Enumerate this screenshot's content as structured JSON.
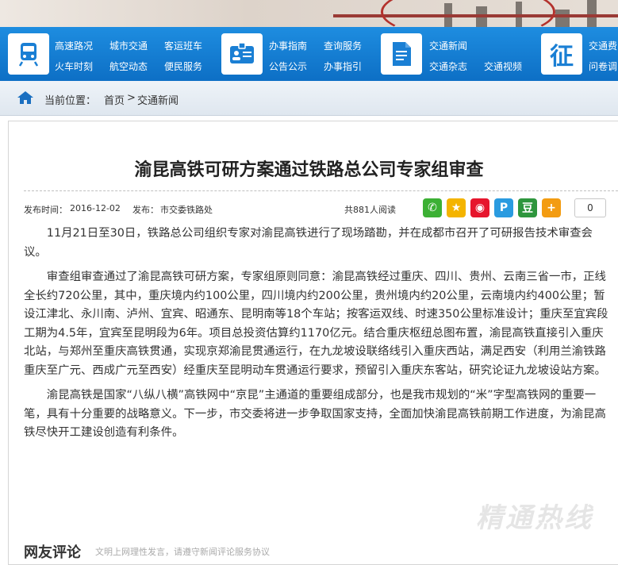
{
  "nav": {
    "groups": [
      {
        "icon": "train-icon",
        "links": [
          "高速路况",
          "城市交通",
          "客运班车",
          "火车时刻",
          "航空动态",
          "便民服务"
        ]
      },
      {
        "icon": "id-card-icon",
        "links": [
          "办事指南",
          "查询服务",
          "公告公示",
          "办事指引"
        ]
      },
      {
        "icon": "document-icon",
        "links": [
          "交通新闻",
          "交通视频",
          "交通杂志"
        ]
      },
      {
        "icon": "levy-icon",
        "icon_text": "征",
        "links": [
          "交通费",
          "问卷调"
        ]
      }
    ]
  },
  "breadcrumb": {
    "prefix": "当前位置：",
    "home": "首页",
    "sep": ">",
    "current": "交通新闻"
  },
  "article": {
    "title": "渝昆高铁可研方案通过铁路总公司专家组审查",
    "publish_label": "发布时间：",
    "publish_date": "2016-12-02",
    "source_label": "发布：",
    "source": "市交委铁路处",
    "reads": "共881人阅读",
    "share_count": "0",
    "paragraphs": [
      "11月21日至30日，铁路总公司组织专家对渝昆高铁进行了现场踏勘，并在成都市召开了可研报告技术审查会议。",
      "审查组审查通过了渝昆高铁可研方案，专家组原则同意：渝昆高铁经过重庆、四川、贵州、云南三省一市，正线全长约720公里，其中，重庆境内约100公里，四川境内约200公里，贵州境内约20公里，云南境内约400公里；暂设江津北、永川南、泸州、宜宾、昭通东、昆明南等18个车站；按客运双线、时速350公里标准设计；重庆至宜宾段工期为4.5年，宜宾至昆明段为6年。项目总投资估算约1170亿元。结合重庆枢纽总图布置，渝昆高铁直接引入重庆北站，与郑州至重庆高铁贯通，实现京郑渝昆贯通运行，在九龙坡设联络线引入重庆西站，满足西安（利用兰渝铁路重庆至广元、西成广元至西安）经重庆至昆明动车贯通运行要求，预留引入重庆东客站，研究论证九龙坡设站方案。",
      "渝昆高铁是国家“八纵八横”高铁网中“京昆”主通道的重要组成部分，也是我市规划的“米”字型高铁网的重要一笔，具有十分重要的战略意义。下一步，市交委将进一步争取国家支持，全面加快渝昆高铁前期工作进度，为渝昆高铁尽快开工建设创造有利条件。"
    ]
  },
  "share_buttons": [
    {
      "name": "wechat-share-icon",
      "color": "#3cb034",
      "glyph": "✆"
    },
    {
      "name": "qzone-share-icon",
      "color": "#f4b400",
      "glyph": "★"
    },
    {
      "name": "weibo-share-icon",
      "color": "#e6162d",
      "glyph": "◉"
    },
    {
      "name": "tencent-weibo-share-icon",
      "color": "#2a9be0",
      "glyph": "P"
    },
    {
      "name": "douban-share-icon",
      "color": "#2e963d",
      "glyph": "豆"
    },
    {
      "name": "more-share-icon",
      "color": "#f39c12",
      "glyph": "+"
    }
  ],
  "comments": {
    "title": "网友评论",
    "note": "文明上网理性发言，请遵守新闻评论服务协议"
  },
  "watermark": "精通热线",
  "colors": {
    "nav": "#1180d6",
    "accent": "#0d6fc5"
  }
}
